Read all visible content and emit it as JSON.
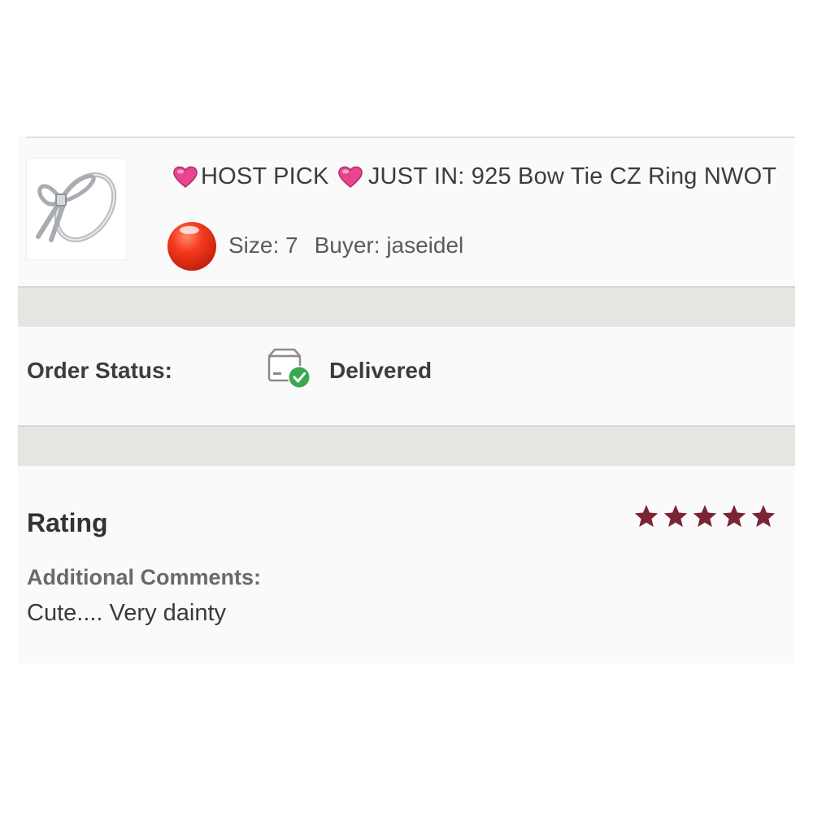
{
  "product": {
    "title_part1": "HOST PICK",
    "title_part2": "JUST IN: 925 Bow Tie CZ Ring NWOT",
    "size_text": "Size: 7",
    "buyer_text": "Buyer: jaseidel",
    "image_icon": "bow-ring-icon",
    "emoji_icon": "pink-heart-icon",
    "status_dot_icon": "red-ball-icon"
  },
  "order": {
    "status_label": "Order Status:",
    "status_value": "Delivered",
    "status_icon": "package-delivered-icon"
  },
  "rating": {
    "label": "Rating",
    "stars": 5,
    "max_stars": 5,
    "star_color": "#7b2436"
  },
  "comments": {
    "label": "Additional Comments:",
    "text": "Cute.... Very dainty"
  }
}
